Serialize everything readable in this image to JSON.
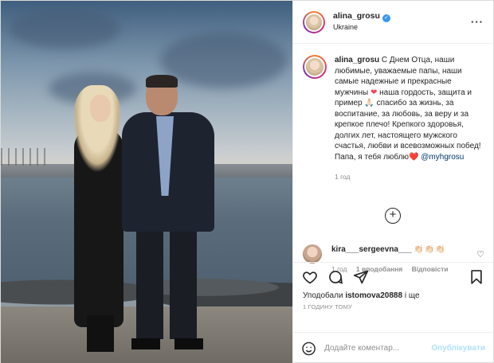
{
  "post": {
    "username": "alina_grosu",
    "location": "Ukraine",
    "more_icon": "ellipsis-icon",
    "caption": {
      "username": "alina_grosu",
      "text_part1": "С Днем Отца, наши любимые, уважаемые папы, наши самые надежные и прекрасные мужчины",
      "heart": "❤",
      "text_part2": "наша гордость, защита и пример ",
      "emoji_a": "🙏🏻",
      "text_part3": " спасибо за жизнь, за воспитание, за любовь, за веру и за крепкое плечо! Крепкого здоровья, долгих лет, настоящего мужского счастья, любви и всевозможных побед!",
      "text_part4": "Папа, я тебя люблю",
      "emoji_b": "❤️",
      "mention": "@myhgrosu",
      "time": "1 год"
    },
    "add_comment_icon": "plus-circle-icon",
    "comment": {
      "username": "kira___sergeevna___",
      "emoji": "👏🏻👏🏻👏🏻",
      "time": "1 год",
      "likes": "1 вподобання",
      "reply": "Відповісти"
    },
    "actions": {
      "like": "heart-icon",
      "comment": "comment-icon",
      "share": "paper-plane-icon",
      "save": "bookmark-icon"
    },
    "likes_prefix": "Уподобали ",
    "likes_user": "istomova20888",
    "likes_suffix": " і ще",
    "timestamp": "1 годину тому",
    "input_placeholder": "Додайте коментар...",
    "publish_label": "Опублікувати",
    "colors": {
      "accent": "#3897f0",
      "muted": "#8e8e8e",
      "publish_disabled": "#b2dffc",
      "heart": "#ed4956"
    }
  }
}
